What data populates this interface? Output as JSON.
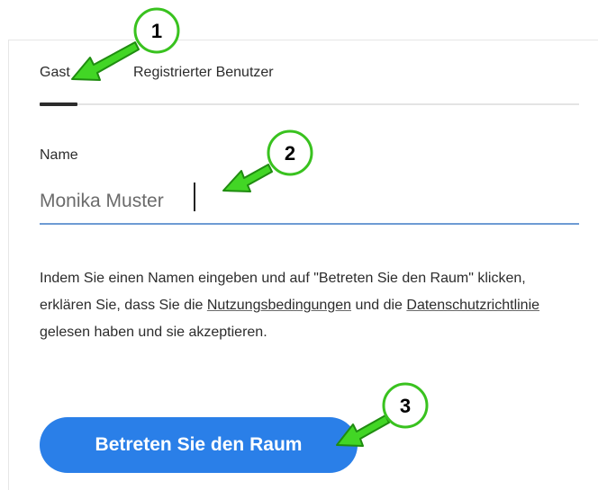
{
  "tabs": {
    "guest_label": "Gast",
    "registered_label": "Registrierter Benutzer",
    "active": "Gast"
  },
  "form": {
    "name_label": "Name",
    "name_value": "Monika Muster"
  },
  "consent": {
    "text_before": "Indem Sie einen Namen eingeben und auf \"Betreten Sie den Raum\" klicken, erklären Sie, dass Sie die ",
    "terms_link": "Nutzungsbedingungen",
    "text_middle": " und die ",
    "privacy_link": "Datenschutzrichtlinie",
    "text_after": " gelesen haben und sie akzeptieren."
  },
  "actions": {
    "enter_label": "Betreten Sie den Raum"
  },
  "annotations": {
    "markers": [
      "1",
      "2",
      "3"
    ],
    "marker_fill": "#ffffff",
    "marker_ring": "#39c21f",
    "arrow_fill": "#42d625",
    "arrow_outline": "#1f8c10"
  },
  "colors": {
    "accent_blue": "#2a7fe8",
    "input_underline": "#6e9bd4",
    "text": "#2c2c2c"
  }
}
